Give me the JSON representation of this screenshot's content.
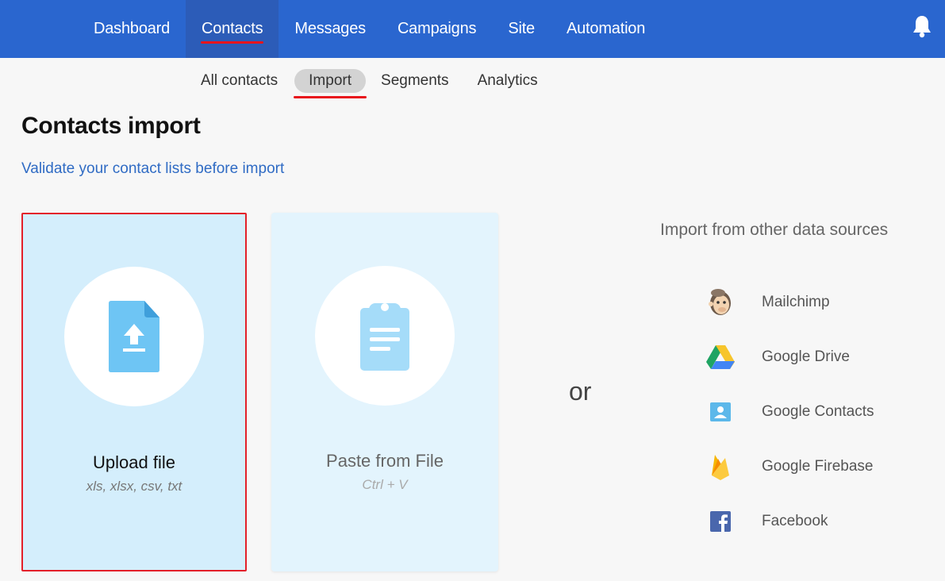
{
  "topnav": {
    "items": [
      {
        "label": "Dashboard"
      },
      {
        "label": "Contacts"
      },
      {
        "label": "Messages"
      },
      {
        "label": "Campaigns"
      },
      {
        "label": "Site"
      },
      {
        "label": "Automation"
      }
    ],
    "active": "Contacts",
    "notification_icon": "bell-icon"
  },
  "subnav": {
    "items": [
      {
        "label": "All contacts"
      },
      {
        "label": "Import"
      },
      {
        "label": "Segments"
      },
      {
        "label": "Analytics"
      }
    ],
    "active": "Import"
  },
  "page": {
    "title": "Contacts import",
    "validate_link": "Validate your contact lists before import"
  },
  "cards": {
    "upload": {
      "title": "Upload file",
      "subtitle": "xls, xlsx, csv, txt",
      "icon": "file-upload-icon"
    },
    "paste": {
      "title": "Paste from File",
      "subtitle": "Ctrl + V",
      "icon": "clipboard-icon"
    }
  },
  "separator": "or",
  "sources": {
    "title": "Import from other data sources",
    "items": [
      {
        "label": "Mailchimp",
        "icon": "mailchimp-icon"
      },
      {
        "label": "Google Drive",
        "icon": "google-drive-icon"
      },
      {
        "label": "Google Contacts",
        "icon": "google-contacts-icon"
      },
      {
        "label": "Google Firebase",
        "icon": "firebase-icon"
      },
      {
        "label": "Facebook",
        "icon": "facebook-icon"
      }
    ]
  },
  "colors": {
    "header_bg": "#2a66cf",
    "active_underline": "#e8141c",
    "link": "#2f6bc4",
    "upload_card_bg": "#d4eefc",
    "paste_card_bg": "#e3f4fd",
    "icon_blue": "#6ec5f4"
  }
}
